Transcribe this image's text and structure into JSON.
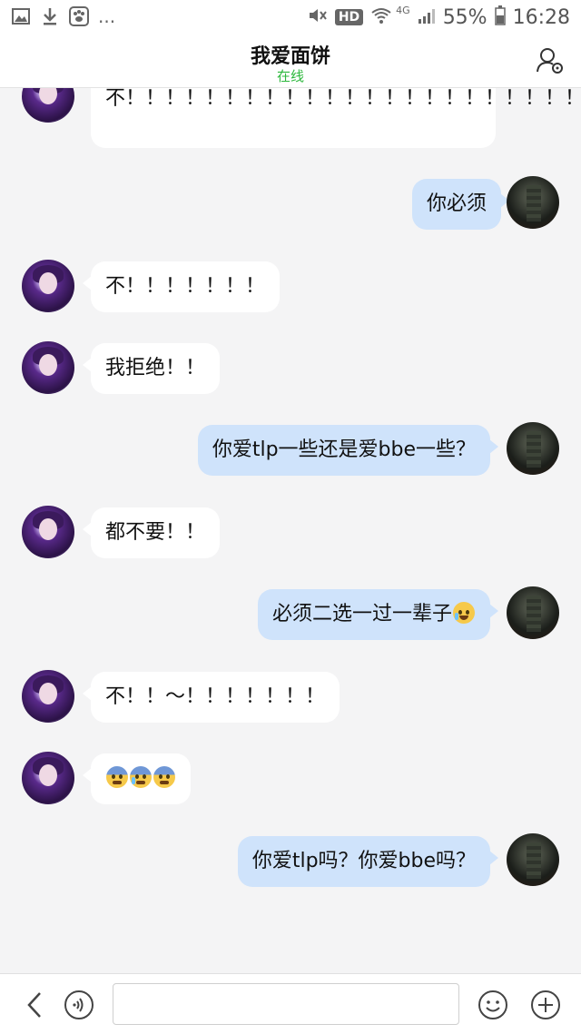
{
  "status_bar": {
    "icons_left": [
      "gallery-icon",
      "download-icon",
      "paw-icon"
    ],
    "overflow": "...",
    "hd_badge": "HD",
    "network": "4G",
    "battery": "55%",
    "time": "16:28"
  },
  "header": {
    "title": "我爱面饼",
    "subtitle": "在线",
    "subtitle_color": "#2db83d",
    "right_icon": "contact-settings-icon"
  },
  "messages": [
    {
      "side": "left",
      "text": "不！！！！！！！！！！！！！！！！！！！！！！！"
    },
    {
      "side": "right",
      "text": "你必须"
    },
    {
      "side": "left",
      "text": "不！！！！！！！"
    },
    {
      "side": "left",
      "text": "我拒绝！！"
    },
    {
      "side": "right",
      "text": "你爱tlp一些还是爱bbe一些？"
    },
    {
      "side": "left",
      "text": "都不要！！"
    },
    {
      "side": "right",
      "text": "必须二选一过一辈子",
      "emoji": "tears-of-joy"
    },
    {
      "side": "left",
      "text": "不！！～！！！！！！！"
    },
    {
      "side": "left",
      "text": "",
      "emoji": [
        "fearful",
        "anxious-sweat",
        "fearful"
      ]
    },
    {
      "side": "right",
      "text": "你爱tlp吗？你爱bbe吗？"
    }
  ],
  "colors": {
    "background": "#f4f4f5",
    "bubble_sent": "#cfe3fb",
    "bubble_received": "#ffffff"
  },
  "bottom_bar": {
    "icons": [
      "back-icon",
      "voice-icon",
      "emoji-icon",
      "plus-icon"
    ],
    "input_value": ""
  }
}
